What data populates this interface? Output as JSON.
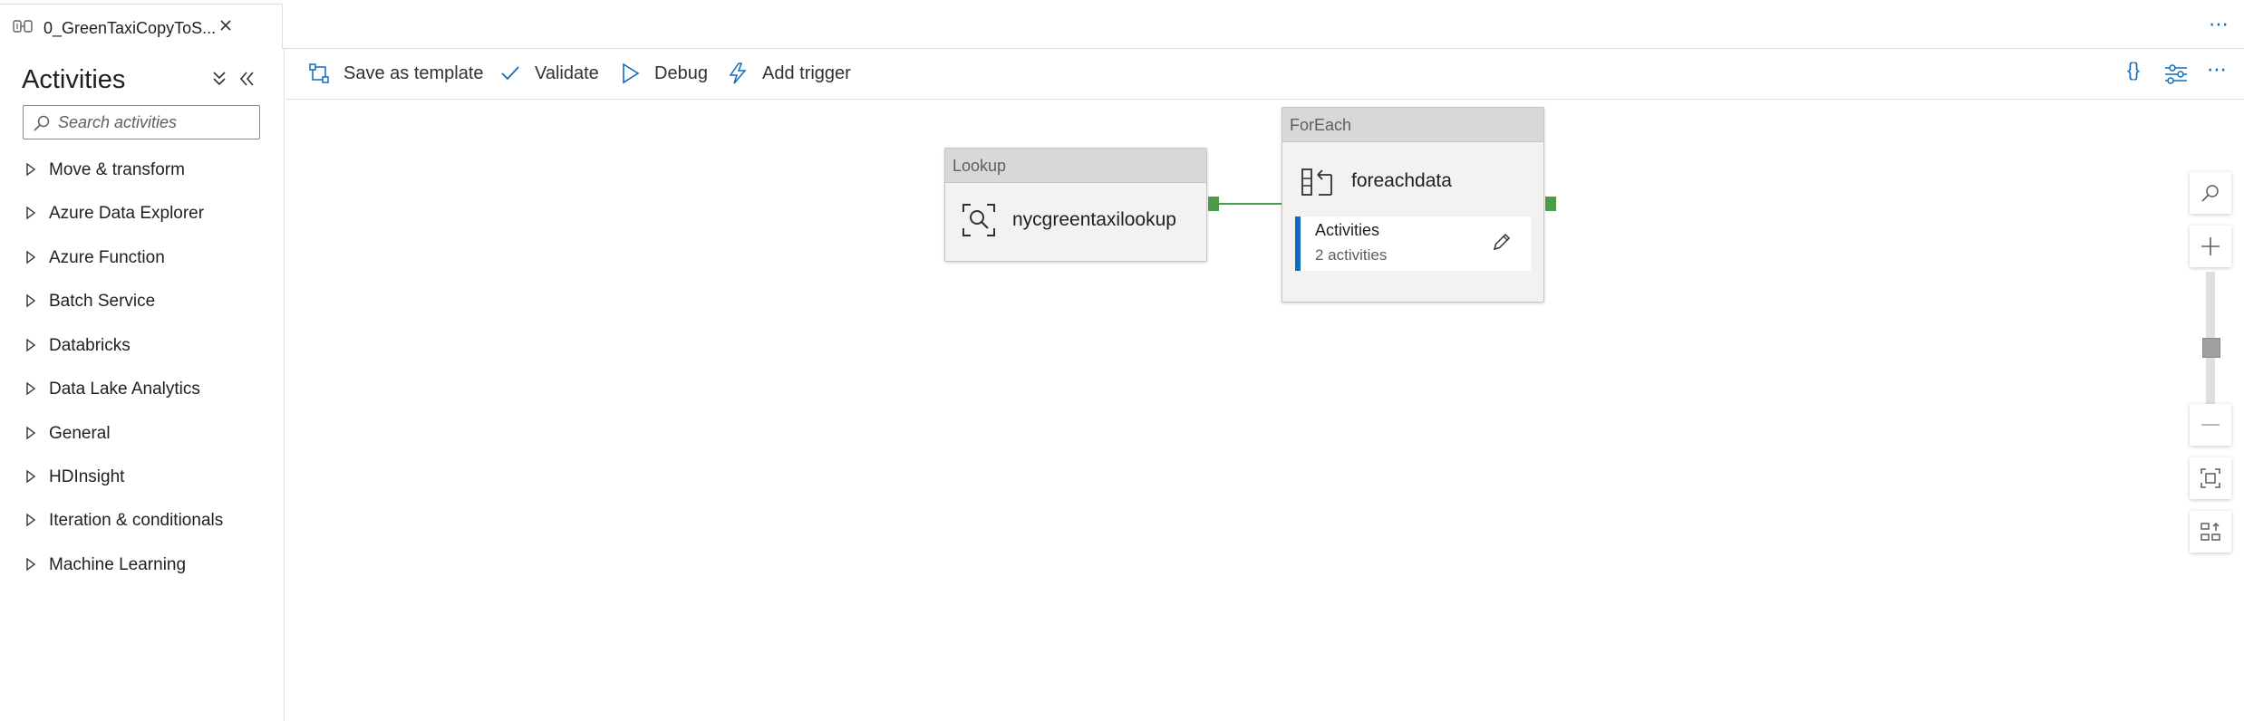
{
  "tab": {
    "title": "0_GreenTaxiCopyToS...",
    "icon": "pipeline-icon",
    "close_icon": "close-icon"
  },
  "tabbar_more": "⋯",
  "sidebar": {
    "title": "Activities",
    "search_placeholder": "Search activities",
    "categories": [
      "Move & transform",
      "Azure Data Explorer",
      "Azure Function",
      "Batch Service",
      "Databricks",
      "Data Lake Analytics",
      "General",
      "HDInsight",
      "Iteration & conditionals",
      "Machine Learning"
    ]
  },
  "toolbar": {
    "save_template": "Save as template",
    "validate": "Validate",
    "debug": "Debug",
    "add_trigger": "Add trigger",
    "code_icon": "{}",
    "more": "⋯"
  },
  "canvas": {
    "lookup": {
      "type": "Lookup",
      "name": "nycgreentaxilookup"
    },
    "foreach": {
      "type": "ForEach",
      "name": "foreachdata",
      "inner_title": "Activities",
      "inner_count": "2 activities"
    }
  },
  "colors": {
    "accent": "#0f6cbd",
    "success_port": "#4c9a4c",
    "node_header": "#d9d8d7"
  }
}
